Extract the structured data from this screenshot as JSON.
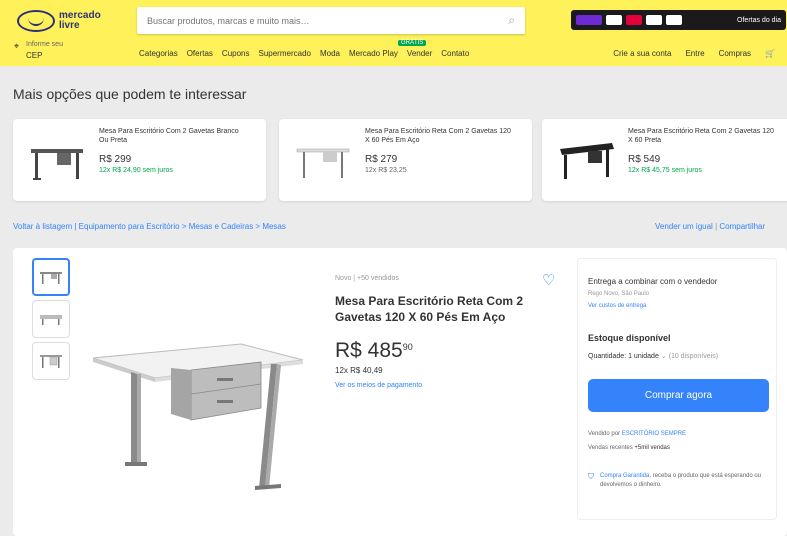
{
  "header": {
    "logo_text": "mercado livre",
    "search_placeholder": "Buscar produtos, marcas e muito mais…",
    "promo_text": "Ofertas do dia",
    "cep_label": "Informe seu",
    "cep_value": "CEP",
    "nav": [
      "Categorias",
      "Ofertas",
      "Cupons",
      "Supermercado",
      "Moda",
      "Mercado Play",
      "Vender",
      "Contato"
    ],
    "nav_badge": "GRÁTIS",
    "user_nav": [
      "Crie a sua conta",
      "Entre",
      "Compras"
    ],
    "cart_icon": "cart-icon"
  },
  "recommendations": {
    "title": "Mais opções que podem te interessar",
    "items": [
      {
        "name": "Mesa Para Escritório Com 2 Gavetas Branco Ou Preta",
        "price": "R$ 299",
        "installments": "12x R$ 24,90 sem juros"
      },
      {
        "name": "Mesa Para Escritório Reta Com 2 Gavetas 120 X 60 Pés Em Aço",
        "price": "R$ 279",
        "installments": "12x R$ 23,25"
      },
      {
        "name": "Mesa Para Escritório Reta Com 2 Gavetas 120 X 60 Preta",
        "price": "R$ 549",
        "installments": "12x R$ 45,75 sem juros"
      }
    ]
  },
  "breadcrumb": "Voltar à listagem  |  Equipamento para Escritório  >  Mesas e Cadeiras  >  Mesas",
  "breadcrumb_right": [
    "Vender um igual",
    "Compartilhar"
  ],
  "product": {
    "condition": "Novo  |  +50 vendidos",
    "title": "Mesa Para Escritório Reta Com 2 Gavetas 120 X 60 Pés Em Aço",
    "price_int": "R$ 485",
    "price_cents": "90",
    "installments": "12x R$ 40,49",
    "payment_link": "Ver os meios de pagamento"
  },
  "side": {
    "delivery": "Entrega a combinar com o vendedor",
    "location": "Rego Novo, São Paulo",
    "location_link": "Ver custos de entrega",
    "stock_label": "Estoque disponível",
    "quantity": "Quantidade: 1 unidade",
    "quantity_extra": "(10 disponíveis)",
    "cta": "Comprar agora",
    "seller_label": "Vendido por",
    "seller_name": "ESCRITÓRIO SEMPRE",
    "sales_label": "Vendas recentes",
    "sales_value": "+5mil vendas",
    "protection_link": "Compra Garantida",
    "protection_text": ", receba o produto que está esperando ou devolvemos o dinheiro."
  },
  "colors": {
    "header_bg": "#fff159",
    "accent": "#3483fa",
    "green": "#00a650"
  }
}
